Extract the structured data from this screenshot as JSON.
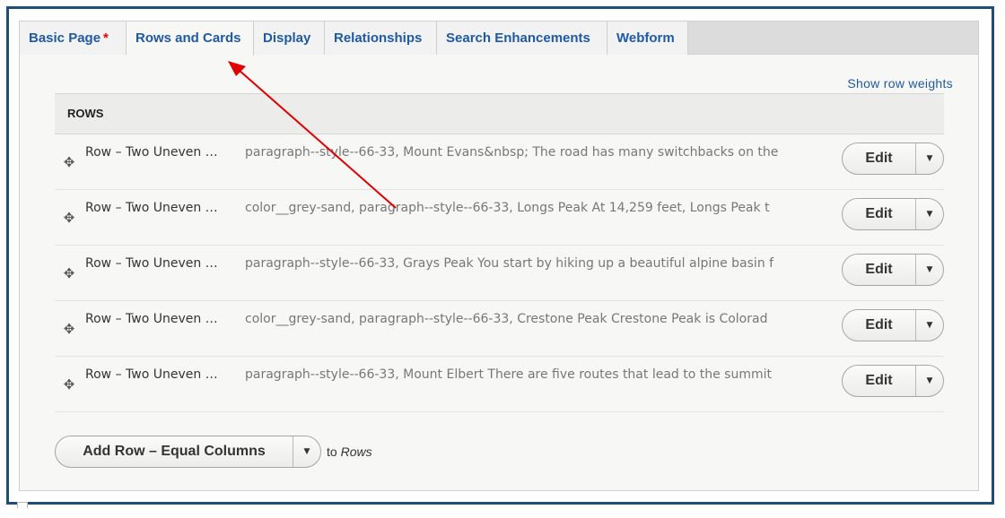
{
  "tabs": [
    {
      "label": "Basic Page",
      "required": "*"
    },
    {
      "label": "Rows and Cards"
    },
    {
      "label": "Display"
    },
    {
      "label": "Relationships"
    },
    {
      "label": "Search Enhancements"
    },
    {
      "label": "Webform"
    }
  ],
  "active_tab": "Rows and Cards",
  "show_row_weights": "Show row weights",
  "rows_header": "ROWS",
  "rows": [
    {
      "title": "Row – Two Uneven …",
      "summary": "paragraph--style--66-33, Mount Evans&nbsp; The road has many switchbacks on the",
      "edit_label": "Edit"
    },
    {
      "title": "Row – Two Uneven …",
      "summary": "color__grey-sand, paragraph--style--66-33, Longs Peak At 14,259 feet, Longs Peak t",
      "edit_label": "Edit"
    },
    {
      "title": "Row – Two Uneven …",
      "summary": "paragraph--style--66-33, Grays Peak You start by hiking up a beautiful alpine basin f",
      "edit_label": "Edit"
    },
    {
      "title": "Row – Two Uneven …",
      "summary": "color__grey-sand, paragraph--style--66-33, Crestone Peak Crestone Peak is Colorad",
      "edit_label": "Edit"
    },
    {
      "title": "Row – Two Uneven …",
      "summary": "paragraph--style--66-33, Mount Elbert There are five routes that lead to the summit",
      "edit_label": "Edit"
    }
  ],
  "add_row": {
    "button_label": "Add Row – Equal Columns",
    "to_prefix": "to",
    "target": "Rows"
  },
  "colors": {
    "frame_border": "#1f4e79",
    "link": "#1f5aa5",
    "required": "#e00000",
    "annotation_arrow": "#e00000"
  },
  "icons": {
    "drag_handle": "move-arrows-icon",
    "dropdown": "caret-down-icon",
    "annotation": "red-arrow-annotation"
  }
}
